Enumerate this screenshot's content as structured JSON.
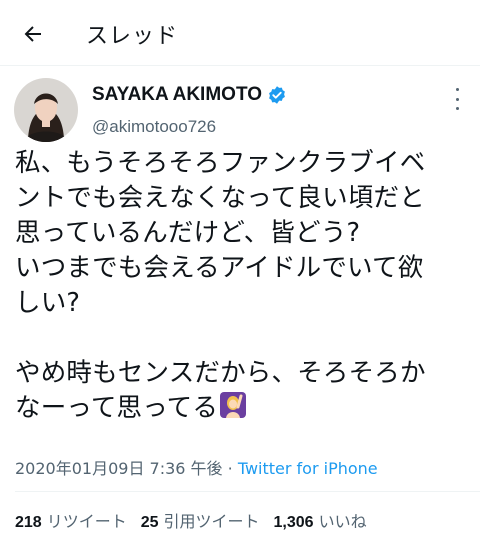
{
  "header": {
    "title": "スレッド",
    "back_icon": "arrow-left-icon"
  },
  "tweet": {
    "author": {
      "display_name": "SAYAKA AKIMOTO",
      "handle": "@akimotooo726",
      "verified": true
    },
    "text_lines": [
      "私、もうそろそろファンクラブイベ",
      "ントでも会えなくなって良い頃だと",
      "思っているんだけど、皆どう?",
      "いつまでも会えるアイドルでいて欲",
      "しい?",
      "",
      "やめ時もセンスだから、そろそろか",
      "なーって思ってる"
    ],
    "emoji": "person-raising-hand-emoji",
    "timestamp": "2020年01月09日 7:36 午後",
    "separator": "·",
    "source": "Twitter for iPhone",
    "stats": {
      "retweets": {
        "count": "218",
        "label": "リツイート"
      },
      "quotes": {
        "count": "25",
        "label": "引用ツイート"
      },
      "likes": {
        "count": "1,306",
        "label": "いいね"
      }
    }
  },
  "colors": {
    "accent": "#1d9bf0",
    "secondary_text": "#536471",
    "divider": "#eff3f4"
  }
}
